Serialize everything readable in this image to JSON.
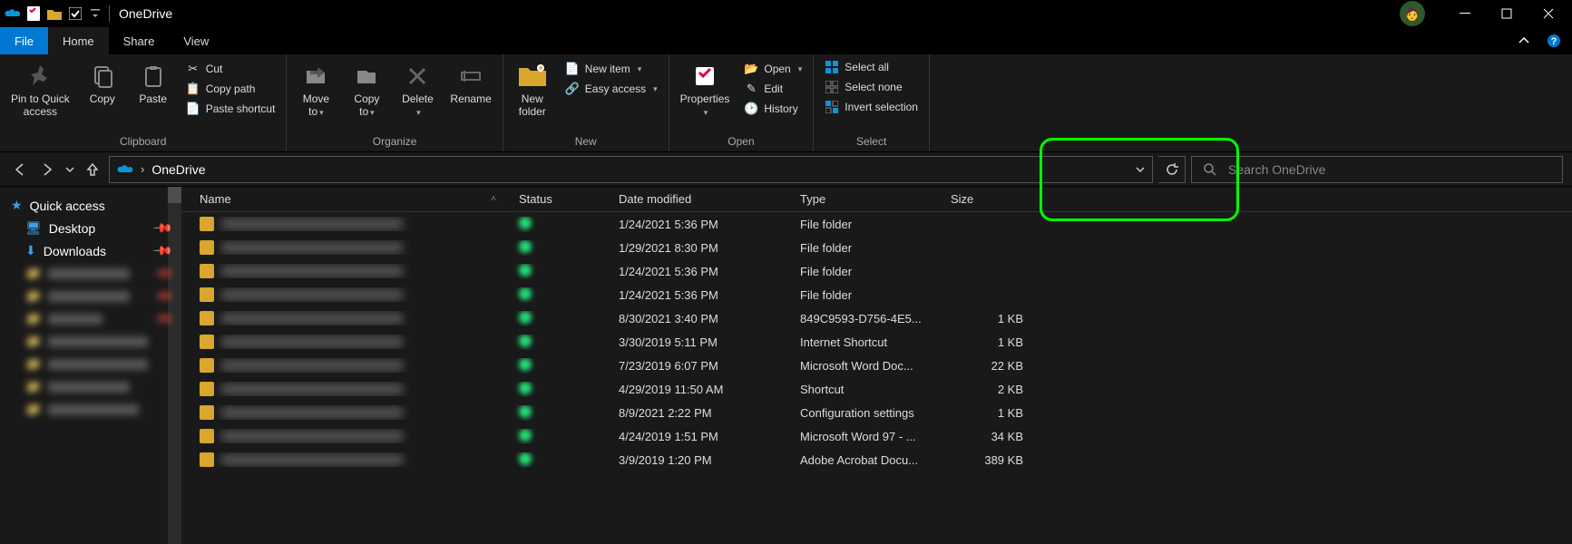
{
  "window": {
    "title": "OneDrive"
  },
  "tabs": {
    "file": "File",
    "home": "Home",
    "share": "Share",
    "view": "View"
  },
  "ribbon": {
    "clipboard": {
      "label": "Clipboard",
      "pin": "Pin to Quick\naccess",
      "copy": "Copy",
      "paste": "Paste",
      "cut": "Cut",
      "copypath": "Copy path",
      "pasteshortcut": "Paste shortcut"
    },
    "organize": {
      "label": "Organize",
      "moveto": "Move\nto",
      "copyto": "Copy\nto",
      "delete": "Delete",
      "rename": "Rename"
    },
    "new": {
      "label": "New",
      "newfolder": "New\nfolder",
      "newitem": "New item",
      "easyaccess": "Easy access"
    },
    "open": {
      "label": "Open",
      "properties": "Properties",
      "open": "Open",
      "edit": "Edit",
      "history": "History"
    },
    "select": {
      "label": "Select",
      "selectall": "Select all",
      "selectnone": "Select none",
      "invert": "Invert selection"
    }
  },
  "address": {
    "location": "OneDrive"
  },
  "search": {
    "placeholder": "Search OneDrive"
  },
  "sidebar": {
    "quickaccess": "Quick access",
    "desktop": "Desktop",
    "downloads": "Downloads"
  },
  "columns": {
    "name": "Name",
    "status": "Status",
    "date": "Date modified",
    "type": "Type",
    "size": "Size"
  },
  "rows": [
    {
      "date": "1/24/2021 5:36 PM",
      "type": "File folder",
      "size": ""
    },
    {
      "date": "1/29/2021 8:30 PM",
      "type": "File folder",
      "size": ""
    },
    {
      "date": "1/24/2021 5:36 PM",
      "type": "File folder",
      "size": ""
    },
    {
      "date": "1/24/2021 5:36 PM",
      "type": "File folder",
      "size": ""
    },
    {
      "date": "8/30/2021 3:40 PM",
      "type": "849C9593-D756-4E5...",
      "size": "1 KB"
    },
    {
      "date": "3/30/2019 5:11 PM",
      "type": "Internet Shortcut",
      "size": "1 KB"
    },
    {
      "date": "7/23/2019 6:07 PM",
      "type": "Microsoft Word Doc...",
      "size": "22 KB"
    },
    {
      "date": "4/29/2019 11:50 AM",
      "type": "Shortcut",
      "size": "2 KB"
    },
    {
      "date": "8/9/2021 2:22 PM",
      "type": "Configuration settings",
      "size": "1 KB"
    },
    {
      "date": "4/24/2019 1:51 PM",
      "type": "Microsoft Word 97 - ...",
      "size": "34 KB"
    },
    {
      "date": "3/9/2019 1:20 PM",
      "type": "Adobe Acrobat Docu...",
      "size": "389 KB"
    }
  ]
}
